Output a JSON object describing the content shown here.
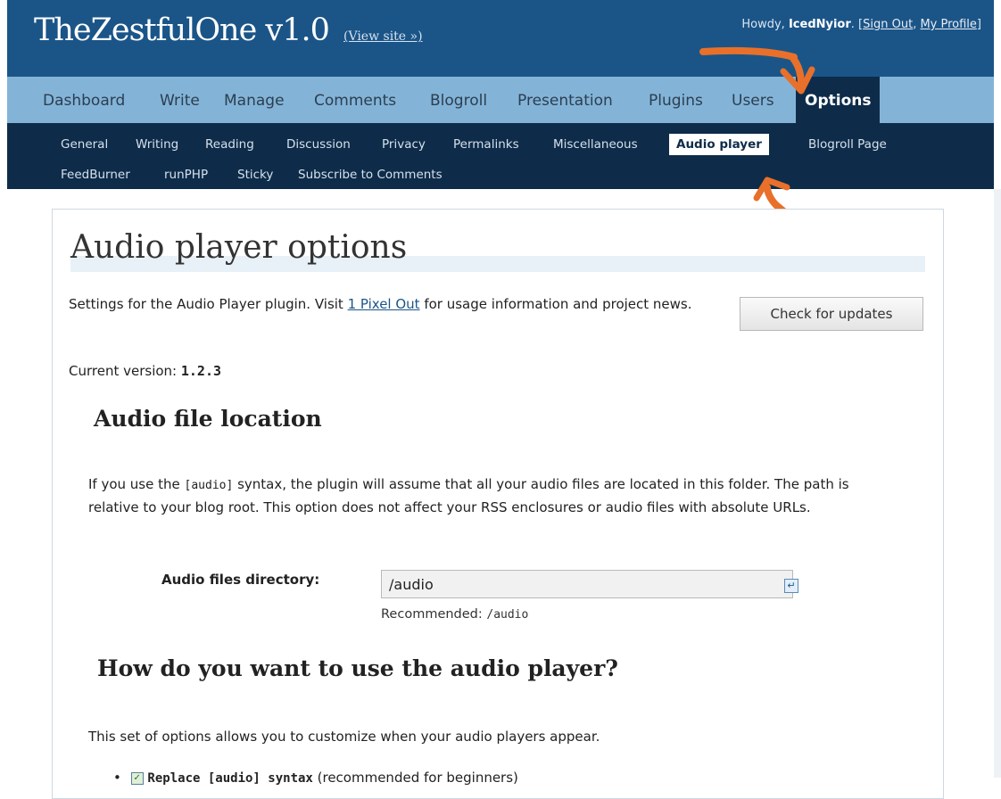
{
  "header": {
    "site_title": "TheZestfulOne v1.0",
    "view_site": "(View site »)",
    "greeting": "Howdy,",
    "username": "IcedNyior",
    "sign_out": "Sign Out",
    "my_profile": "My Profile"
  },
  "main_nav": [
    {
      "label": "Dashboard",
      "active": false
    },
    {
      "label": "Write",
      "active": false
    },
    {
      "label": "Manage",
      "active": false
    },
    {
      "label": "Comments",
      "active": false
    },
    {
      "label": "Blogroll",
      "active": false
    },
    {
      "label": "Presentation",
      "active": false
    },
    {
      "label": "Plugins",
      "active": false
    },
    {
      "label": "Users",
      "active": false
    },
    {
      "label": "Options",
      "active": true
    }
  ],
  "sub_nav": [
    {
      "label": "General",
      "active": false
    },
    {
      "label": "Writing",
      "active": false
    },
    {
      "label": "Reading",
      "active": false
    },
    {
      "label": "Discussion",
      "active": false
    },
    {
      "label": "Privacy",
      "active": false
    },
    {
      "label": "Permalinks",
      "active": false
    },
    {
      "label": "Miscellaneous",
      "active": false
    },
    {
      "label": "Audio player",
      "active": true
    },
    {
      "label": "Blogroll Page",
      "active": false
    },
    {
      "label": "FeedBurner",
      "active": false
    },
    {
      "label": "runPHP",
      "active": false
    },
    {
      "label": "Sticky",
      "active": false
    },
    {
      "label": "Subscribe to Comments",
      "active": false
    }
  ],
  "page": {
    "title": "Audio player options",
    "intro_before": "Settings for the Audio Player plugin. Visit ",
    "intro_link": "1 Pixel Out",
    "intro_after": " for usage information and project news.",
    "check_updates": "Check for updates",
    "version_label": "Current version: ",
    "version_value": "1.2.3"
  },
  "location_section": {
    "heading": "Audio file location",
    "desc_before": "If you use the ",
    "desc_code": "[audio]",
    "desc_after": " syntax, the plugin will assume that all your audio files are located in this folder. The path is relative to your blog root. This option does not affect your RSS enclosures or audio files with absolute URLs.",
    "field_label": "Audio files directory:",
    "field_value": "/audio",
    "recommended_label": "Recommended: ",
    "recommended_value": "/audio"
  },
  "usage_section": {
    "heading": "How do you want to use the audio player?",
    "desc": "This set of options allows you to customize when your audio players appear.",
    "option_label_bold": "Replace [audio] syntax",
    "option_note": "(recommended for beginners)",
    "option_checked": true
  },
  "colors": {
    "header_bg": "#1b5588",
    "main_nav_bg": "#83b4d8",
    "sub_nav_bg": "#0e2c4a",
    "annotation_arrow": "#e8702a"
  }
}
